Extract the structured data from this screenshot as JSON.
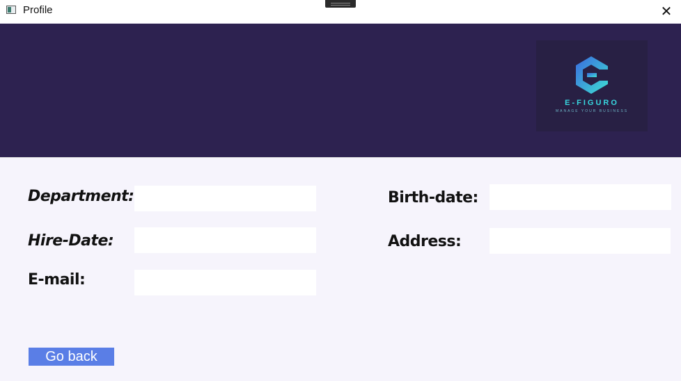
{
  "window": {
    "title": "Profile",
    "close_symbol": "✕"
  },
  "logo": {
    "name": "E-FIGURO",
    "tagline": "MANAGE YOUR BUSINESS",
    "colors": {
      "gradient_start": "#3a6ae0",
      "gradient_end": "#3ee0d2"
    }
  },
  "form": {
    "department_label": "Department:",
    "birth_date_label": "Birth-date:",
    "hire_date_label": "Hire-Date:",
    "address_label": "Address:",
    "email_label": "E-mail:",
    "department_value": "",
    "birth_date_value": "",
    "hire_date_value": "",
    "address_value": "",
    "email_value": ""
  },
  "actions": {
    "go_back_label": "Go back"
  },
  "colors": {
    "header_bg": "#2d2250",
    "body_bg": "#f6f4fc",
    "button_bg": "#5a7ee6"
  }
}
